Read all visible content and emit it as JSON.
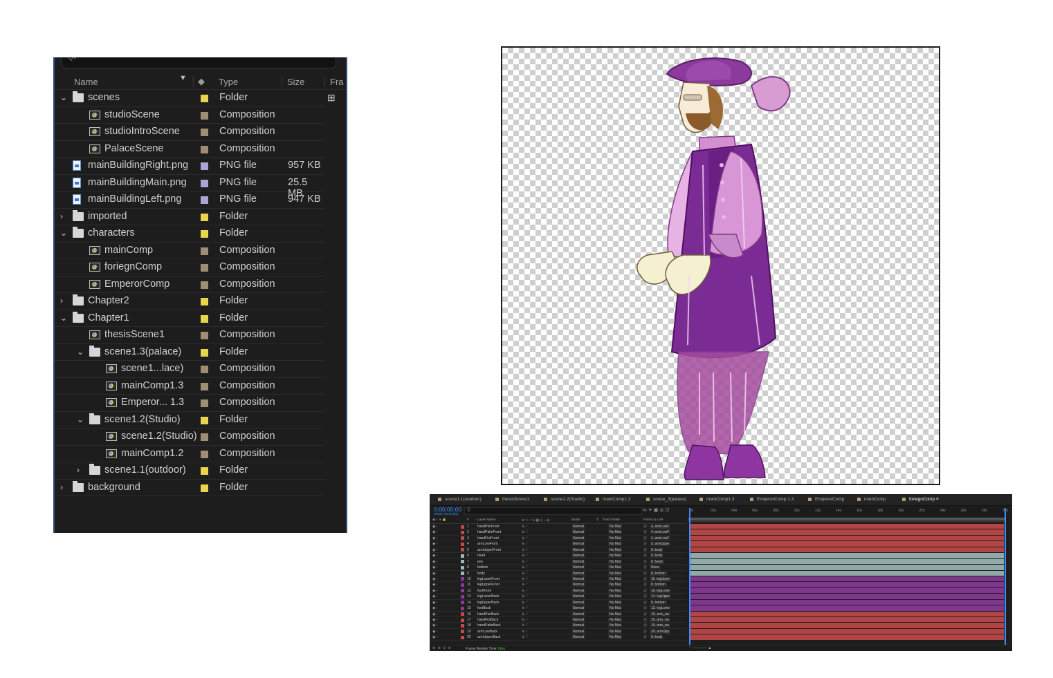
{
  "project": {
    "columns": {
      "name": "Name",
      "type": "Type",
      "size": "Size",
      "frame": "Fra"
    },
    "items": [
      {
        "name": "scenes",
        "type": "Folder",
        "size": "",
        "depth": 0,
        "kind": "folder",
        "twirl": "open",
        "label": "#e8d44d"
      },
      {
        "name": "studioScene",
        "type": "Composition",
        "size": "",
        "depth": 1,
        "kind": "comp",
        "twirl": "",
        "label": "#a08e74"
      },
      {
        "name": "studioIntroScene",
        "type": "Composition",
        "size": "",
        "depth": 1,
        "kind": "comp",
        "twirl": "",
        "label": "#a08e74"
      },
      {
        "name": "PalaceScene",
        "type": "Composition",
        "size": "",
        "depth": 1,
        "kind": "comp",
        "twirl": "",
        "label": "#a08e74"
      },
      {
        "name": "mainBuildingRight.png",
        "type": "PNG file",
        "size": "957 KB",
        "depth": 0,
        "kind": "png",
        "twirl": "",
        "label": "#a9a6d6"
      },
      {
        "name": "mainBuildingMain.png",
        "type": "PNG file",
        "size": "25.5 MB",
        "depth": 0,
        "kind": "png",
        "twirl": "",
        "label": "#a9a6d6"
      },
      {
        "name": "mainBuildingLeft.png",
        "type": "PNG file",
        "size": "947 KB",
        "depth": 0,
        "kind": "png",
        "twirl": "",
        "label": "#a9a6d6"
      },
      {
        "name": "imported",
        "type": "Folder",
        "size": "",
        "depth": 0,
        "kind": "folder",
        "twirl": "closed",
        "label": "#e8d44d"
      },
      {
        "name": "characters",
        "type": "Folder",
        "size": "",
        "depth": 0,
        "kind": "folder",
        "twirl": "open",
        "label": "#e8d44d"
      },
      {
        "name": "mainComp",
        "type": "Composition",
        "size": "",
        "depth": 1,
        "kind": "comp",
        "twirl": "",
        "label": "#a08e74"
      },
      {
        "name": "foriegnComp",
        "type": "Composition",
        "size": "",
        "depth": 1,
        "kind": "comp",
        "twirl": "",
        "label": "#a08e74"
      },
      {
        "name": "EmperorComp",
        "type": "Composition",
        "size": "",
        "depth": 1,
        "kind": "comp",
        "twirl": "",
        "label": "#a08e74"
      },
      {
        "name": "Chapter2",
        "type": "Folder",
        "size": "",
        "depth": 0,
        "kind": "folder",
        "twirl": "closed",
        "label": "#e8d44d"
      },
      {
        "name": "Chapter1",
        "type": "Folder",
        "size": "",
        "depth": 0,
        "kind": "folder",
        "twirl": "open",
        "label": "#e8d44d"
      },
      {
        "name": "thesisScene1",
        "type": "Composition",
        "size": "",
        "depth": 1,
        "kind": "comp",
        "twirl": "",
        "label": "#a08e74"
      },
      {
        "name": "scene1.3(palace)",
        "type": "Folder",
        "size": "",
        "depth": 1,
        "kind": "folder",
        "twirl": "open",
        "label": "#e8d44d"
      },
      {
        "name": "scene1...lace)",
        "type": "Composition",
        "size": "",
        "depth": 2,
        "kind": "comp",
        "twirl": "",
        "label": "#a08e74"
      },
      {
        "name": "mainComp1.3",
        "type": "Composition",
        "size": "",
        "depth": 2,
        "kind": "comp",
        "twirl": "",
        "label": "#a08e74"
      },
      {
        "name": "Emperor... 1.3",
        "type": "Composition",
        "size": "",
        "depth": 2,
        "kind": "comp",
        "twirl": "",
        "label": "#a08e74"
      },
      {
        "name": "scene1.2(Studio)",
        "type": "Folder",
        "size": "",
        "depth": 1,
        "kind": "folder",
        "twirl": "open",
        "label": "#e8d44d"
      },
      {
        "name": "scene1.2(Studio)",
        "type": "Composition",
        "size": "",
        "depth": 2,
        "kind": "comp",
        "twirl": "",
        "label": "#a08e74"
      },
      {
        "name": "mainComp1.2",
        "type": "Composition",
        "size": "",
        "depth": 2,
        "kind": "comp",
        "twirl": "",
        "label": "#a08e74"
      },
      {
        "name": "scene1.1(outdoor)",
        "type": "Folder",
        "size": "",
        "depth": 1,
        "kind": "folder",
        "twirl": "closed",
        "label": "#e8d44d"
      },
      {
        "name": "background",
        "type": "Folder",
        "size": "",
        "depth": 0,
        "kind": "folder",
        "twirl": "closed",
        "label": "#e8d44d"
      }
    ]
  },
  "timeline": {
    "tabs": [
      {
        "label": "scene1.1(outdoor)",
        "active": false
      },
      {
        "label": "thesisScene1",
        "active": false
      },
      {
        "label": "scene1.2(Studio)",
        "active": false
      },
      {
        "label": "mainComp1.2",
        "active": false
      },
      {
        "label": "scene_3(palace)",
        "active": false
      },
      {
        "label": "mainComp1.3",
        "active": false
      },
      {
        "label": "EmperorComp 1.3",
        "active": false
      },
      {
        "label": "EmperorComp",
        "active": false
      },
      {
        "label": "mainComp",
        "active": false
      },
      {
        "label": "foriegnComp",
        "active": true
      }
    ],
    "timecode": "0:00:00:00",
    "fps": "00000 (30.00 fps)",
    "search_placeholder": "Q",
    "headers": {
      "num": "#",
      "layer_name": "Layer Name",
      "mode": "Mode",
      "t": "T",
      "track_matte": "Track Matte",
      "parent": "Parent & Link"
    },
    "ruler": [
      "0s",
      "02s",
      "04s",
      "06s",
      "08s",
      "10s",
      "12s",
      "14s",
      "16s",
      "18s",
      "20s",
      "22s",
      "24s",
      "26s",
      "28s",
      "30s"
    ],
    "layers": [
      {
        "num": "1",
        "name": "handPenFront",
        "mode": "Normal",
        "matte": "No Mat",
        "parent": "4. armLowF",
        "color": "#c24a4a"
      },
      {
        "num": "2",
        "name": "handPalmFront",
        "mode": "Normal",
        "matte": "No Mat",
        "parent": "4. armLowF",
        "color": "#c24a4a"
      },
      {
        "num": "3",
        "name": "handFistFront",
        "mode": "Normal",
        "matte": "No Mat",
        "parent": "4. armLowF",
        "color": "#c24a4a"
      },
      {
        "num": "4",
        "name": "armLowFront",
        "mode": "Normal",
        "matte": "No Mat",
        "parent": "5. armUppe",
        "color": "#c24a4a"
      },
      {
        "num": "5",
        "name": "armUpperFront",
        "mode": "Normal",
        "matte": "No Mat",
        "parent": "9. body",
        "color": "#c24a4a"
      },
      {
        "num": "6",
        "name": "head",
        "mode": "Normal",
        "matte": "No Mat",
        "parent": "9. body",
        "color": "#9db8b8"
      },
      {
        "num": "7",
        "name": "eye",
        "mode": "Normal",
        "matte": "No Mat",
        "parent": "6. head",
        "color": "#9db8b8"
      },
      {
        "num": "8",
        "name": "bottom",
        "mode": "Normal",
        "matte": "No Mat",
        "parent": "None",
        "color": "#9db8b8"
      },
      {
        "num": "9",
        "name": "body",
        "mode": "Normal",
        "matte": "No Mat",
        "parent": "8. bottom",
        "color": "#9db8b8"
      },
      {
        "num": "10",
        "name": "legLowerFront",
        "mode": "Normal",
        "matte": "No Mat",
        "parent": "11. legUppe",
        "color": "#8a3a9a"
      },
      {
        "num": "11",
        "name": "legUpperFront",
        "mode": "Normal",
        "matte": "No Mat",
        "parent": "8. bottom",
        "color": "#8a3a9a"
      },
      {
        "num": "12",
        "name": "footFront",
        "mode": "Normal",
        "matte": "No Mat",
        "parent": "10. legLowe",
        "color": "#8a3a9a"
      },
      {
        "num": "13",
        "name": "legLowerBack",
        "mode": "Normal",
        "matte": "No Mat",
        "parent": "14. legUppe",
        "color": "#8a3a9a"
      },
      {
        "num": "14",
        "name": "legUpperBack",
        "mode": "Normal",
        "matte": "No Mat",
        "parent": "8. bottom",
        "color": "#8a3a9a"
      },
      {
        "num": "15",
        "name": "footBack",
        "mode": "Normal",
        "matte": "No Mat",
        "parent": "13. legLowe",
        "color": "#8a3a9a"
      },
      {
        "num": "16",
        "name": "handPenBack",
        "mode": "Normal",
        "matte": "No Mat",
        "parent": "19. arm_ow",
        "color": "#c24a4a"
      },
      {
        "num": "17",
        "name": "handFistBack",
        "mode": "Normal",
        "matte": "No Mat",
        "parent": "19. arm_ow",
        "color": "#c24a4a"
      },
      {
        "num": "18",
        "name": "handPalmBack",
        "mode": "Normal",
        "matte": "No Mat",
        "parent": "19. arm_ow",
        "color": "#c24a4a"
      },
      {
        "num": "19",
        "name": "armLowBack",
        "mode": "Normal",
        "matte": "No Mat",
        "parent": "20. armUpp",
        "color": "#c24a4a"
      },
      {
        "num": "20",
        "name": "armUpperBack",
        "mode": "Normal",
        "matte": "No Mat",
        "parent": "9. body",
        "color": "#c24a4a"
      }
    ],
    "footer": {
      "label": "Frame Render Time:",
      "value": "0ms"
    }
  },
  "colors": {
    "accent": "#3d8dff",
    "folder_label": "#e8d44d",
    "comp_label": "#a08e74",
    "png_label": "#a9a6d6"
  }
}
